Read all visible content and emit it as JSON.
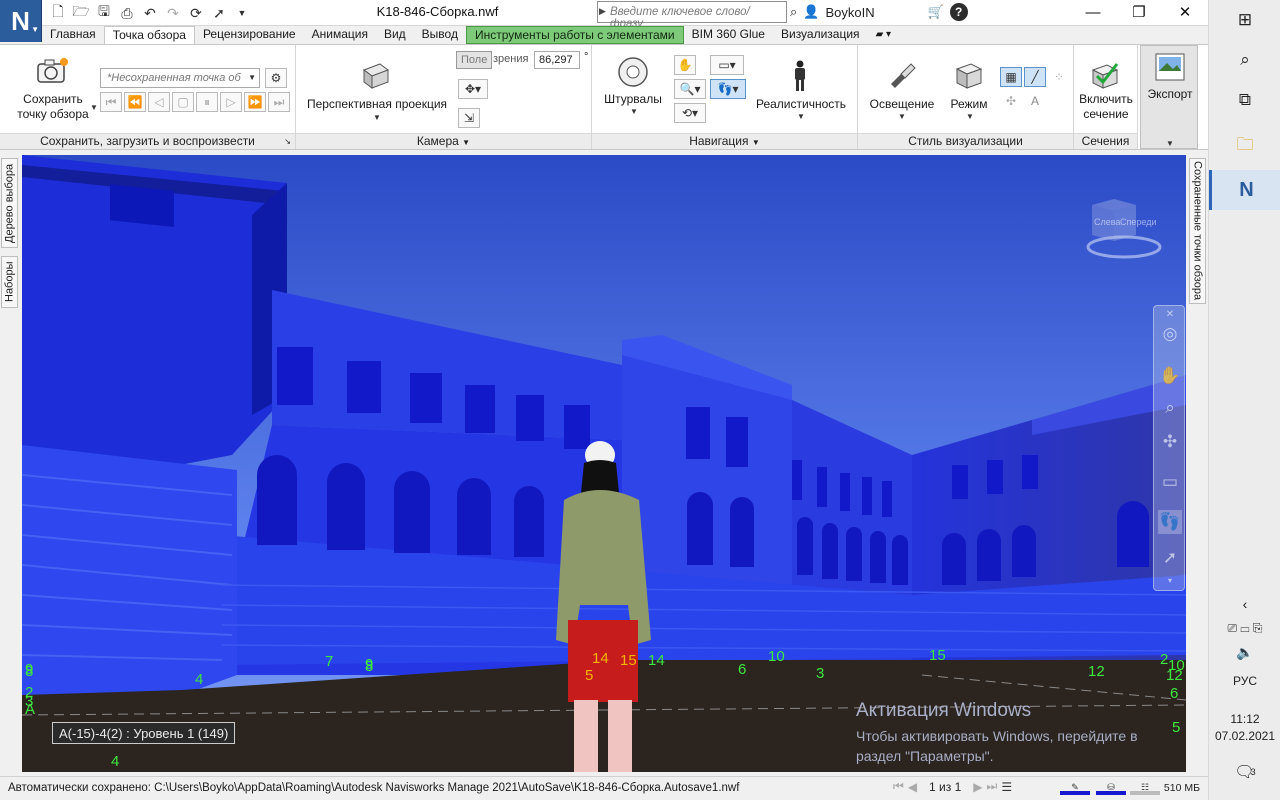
{
  "window": {
    "title": "K18-846-Сборка.nwf",
    "search_placeholder": "Введите ключевое слово/фразу",
    "user": "BoykoIN",
    "help": "?"
  },
  "tabs": [
    "Главная",
    "Точка обзора",
    "Рецензирование",
    "Анимация",
    "Вид",
    "Вывод",
    "Инструменты работы с элементами",
    "BIM 360 Glue",
    "Визуализация"
  ],
  "ribbon": {
    "save": {
      "save_label_1": "Сохранить",
      "save_label_2": "точку обзора",
      "viewpoint_combo": "*Несохраненная точка об",
      "title": "Сохранить, загрузить и воспроизвести"
    },
    "camera": {
      "perspective": "Перспективная проекция",
      "fov_label": "Поле",
      "fov_label_rest": "зрения",
      "fov_value": "86,297",
      "degree": "°",
      "title": "Камера"
    },
    "navigation": {
      "steering": "Штурвалы",
      "realism": "Реалистичность",
      "title": "Навигация"
    },
    "render_style": {
      "lighting": "Освещение",
      "mode": "Режим",
      "title": "Стиль визуализации"
    },
    "sectioning": {
      "enable_1": "Включить",
      "enable_2": "сечение",
      "title": "Сечения"
    },
    "export": {
      "label": "Экспорт"
    }
  },
  "sidebars": {
    "left": [
      "Дерево выбора",
      "Наборы"
    ],
    "right": "Сохраненные точки обзора"
  },
  "viewport": {
    "tooltip": "A(-15)-4(2) : Уровень 1 (149)",
    "activation_title": "Активация Windows",
    "activation_text_1": "Чтобы активировать Windows, перейдите в",
    "activation_text_2": "раздел \"Параметры\".",
    "viewcube_left": "Слева",
    "viewcube_front": "Спереди",
    "grid_labels": [
      {
        "t": "9"
      },
      {
        "t": "8"
      },
      {
        "t": "2"
      },
      {
        "t": "3"
      },
      {
        "t": "A"
      },
      {
        "t": "4"
      },
      {
        "t": "7"
      },
      {
        "t": "9"
      },
      {
        "t": "8"
      },
      {
        "t": "14"
      },
      {
        "t": "15"
      },
      {
        "t": "14"
      },
      {
        "t": "5"
      },
      {
        "t": "6"
      },
      {
        "t": "10"
      },
      {
        "t": "3"
      },
      {
        "t": "15"
      },
      {
        "t": "12"
      },
      {
        "t": "2"
      },
      {
        "t": "10"
      },
      {
        "t": "12"
      },
      {
        "t": "6"
      },
      {
        "t": "5"
      },
      {
        "t": "4"
      }
    ]
  },
  "status": {
    "autosave": "Автоматически сохранено: C:\\Users\\Boyko\\AppData\\Roaming\\Autodesk Navisworks Manage 2021\\AutoSave\\K18-846-Сборка.Autosave1.nwf",
    "page": "1 из 1",
    "memory": "510 МБ"
  },
  "taskbar": {
    "lang": "РУС",
    "time": "11:12",
    "date": "07.02.2021",
    "notifications": "3"
  },
  "colors": {
    "sky_top": "#2f52c9",
    "building": "#2233e0",
    "ground": "#2b241f",
    "grid_label": "#3ee83e",
    "context_tab": "#7ec97a"
  }
}
